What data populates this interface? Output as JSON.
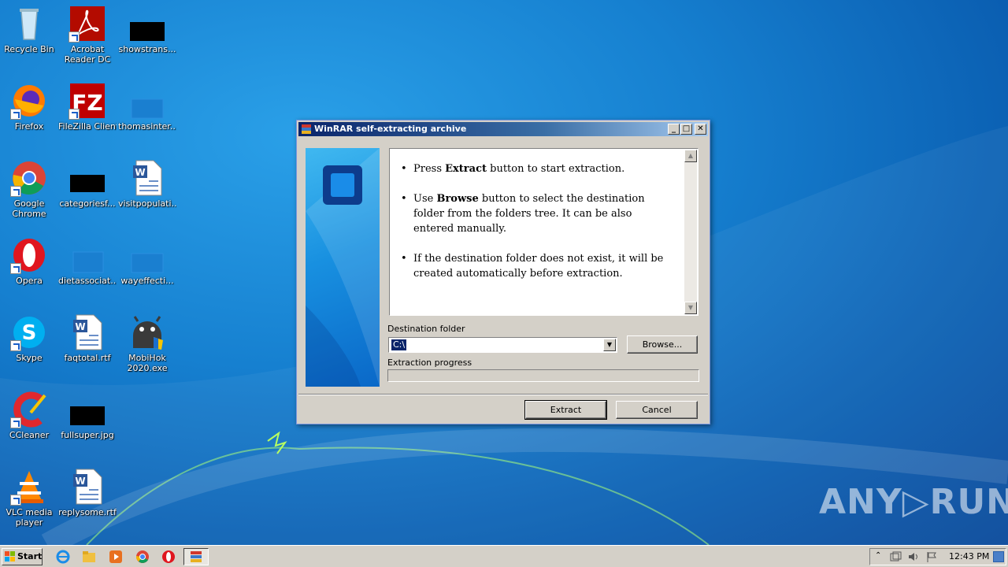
{
  "desktop": {
    "icons": [
      {
        "label": "Recycle Bin",
        "icon": "recycle-bin-icon"
      },
      {
        "label": "Acrobat Reader DC",
        "icon": "acrobat-icon"
      },
      {
        "label": "showstrans...",
        "icon": "black-file-icon"
      },
      {
        "label": "Firefox",
        "icon": "firefox-icon"
      },
      {
        "label": "FileZilla Client",
        "icon": "filezilla-icon"
      },
      {
        "label": "thomasinter...",
        "icon": "blank-file-icon"
      },
      {
        "label": "Google Chrome",
        "icon": "chrome-icon"
      },
      {
        "label": "categoriesf...",
        "icon": "black-file-icon"
      },
      {
        "label": "visitpopulati...",
        "icon": "word-doc-icon"
      },
      {
        "label": "Opera",
        "icon": "opera-icon"
      },
      {
        "label": "dietassociat...",
        "icon": "blank-file-icon"
      },
      {
        "label": "wayeffecti...",
        "icon": "blank-file-icon"
      },
      {
        "label": "Skype",
        "icon": "skype-icon"
      },
      {
        "label": "faqtotal.rtf",
        "icon": "word-doc-icon"
      },
      {
        "label": "MobiHok 2020.exe",
        "icon": "android-icon"
      },
      {
        "label": "CCleaner",
        "icon": "ccleaner-icon"
      },
      {
        "label": "fullsuper.jpg",
        "icon": "black-file-icon"
      },
      {
        "label": "VLC media player",
        "icon": "vlc-icon"
      },
      {
        "label": "replysome.rtf",
        "icon": "word-doc-icon"
      }
    ],
    "watermark": "ANY▷RUN"
  },
  "dialog": {
    "title": "WinRAR self-extracting archive",
    "bullets": [
      {
        "pre": "Press ",
        "bold": "Extract",
        "post": " button to start extraction."
      },
      {
        "pre": "Use ",
        "bold": "Browse",
        "post": " button to select the destination folder from the folders tree. It can be also entered manually."
      },
      {
        "pre": "",
        "bold": "",
        "post": "If the destination folder does not exist, it will be created automatically before extraction."
      }
    ],
    "destination_label": "Destination folder",
    "destination_value": "C:\\",
    "browse_label": "Browse...",
    "progress_label": "Extraction progress",
    "progress": 0,
    "extract_label": "Extract",
    "cancel_label": "Cancel"
  },
  "taskbar": {
    "start_label": "Start",
    "clock": "12:43 PM"
  },
  "colors": {
    "title_active": "#0a246a",
    "desktop_blue": "#1680d0",
    "dialog_face": "#d4d0c8"
  }
}
